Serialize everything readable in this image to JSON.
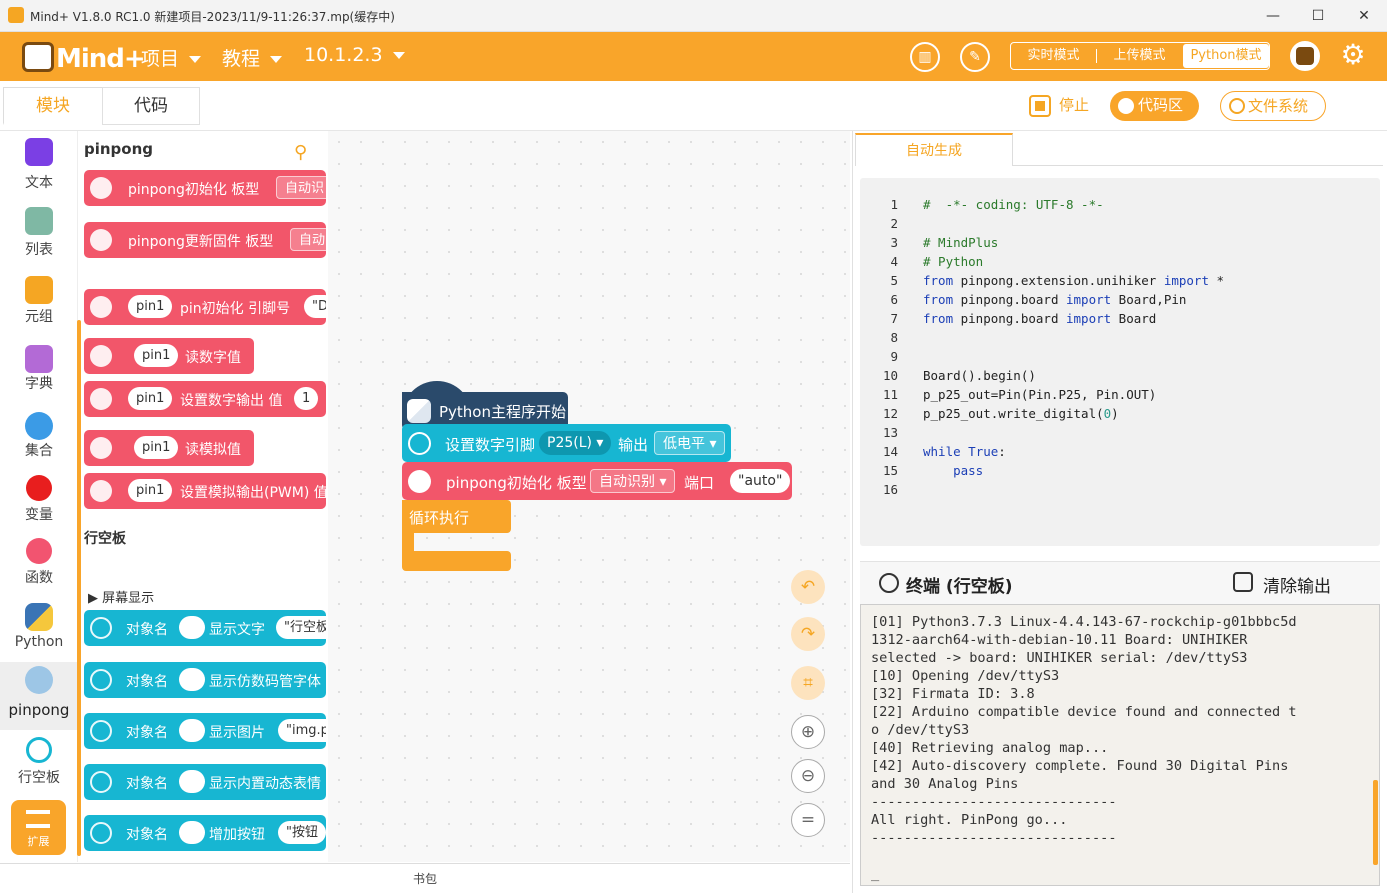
{
  "window": {
    "title": "Mind+ V1.8.0 RC1.0   新建项目-2023/11/9-11:26:37.mp(缓存中)",
    "minimize": "—",
    "maximize": "☐",
    "close": "✕"
  },
  "menubar": {
    "logo_text": "Mind+",
    "menus": [
      "项目",
      "教程",
      "10.1.2.3"
    ],
    "modes": [
      "实时模式",
      "上传模式",
      "Python模式"
    ]
  },
  "tabs": {
    "blocks": "模块",
    "code": "代码",
    "stop": "停止",
    "code_area": "代码区",
    "file_system": "文件系统"
  },
  "sidebar": {
    "items": [
      "文本",
      "列表",
      "元组",
      "字典",
      "集合",
      "变量",
      "函数",
      "Python",
      "pinpong",
      "行空板"
    ],
    "extend": "扩展"
  },
  "palette": {
    "section1": "pinpong",
    "section2": "行空板",
    "subsection": "屏幕显示",
    "red_blocks": [
      {
        "text": "pinpong初始化 板型",
        "slot": "自动识"
      },
      {
        "text": "pinpong更新固件 板型",
        "slot": "自动"
      },
      {
        "pin": "pin1",
        "text": "pin初始化 引脚号",
        "slot": "\"D"
      },
      {
        "pin": "pin1",
        "text": "读数字值",
        "slot": ""
      },
      {
        "pin": "pin1",
        "text": "设置数字输出 值",
        "slot": "1"
      },
      {
        "pin": "pin1",
        "text": "读模拟值",
        "slot": ""
      },
      {
        "pin": "pin1",
        "text": "设置模拟输出(PWM) 值",
        "slot": ""
      }
    ],
    "cyan_blocks": [
      {
        "obj": "对象名",
        "text": "显示文字",
        "slot": "\"行空板"
      },
      {
        "obj": "对象名",
        "text": "显示仿数码管字体",
        "slot": ""
      },
      {
        "obj": "对象名",
        "text": "显示图片",
        "slot": "\"img.p"
      },
      {
        "obj": "对象名",
        "text": "显示内置动态表情",
        "slot": ""
      },
      {
        "obj": "对象名",
        "text": "增加按钮",
        "slot": "\"按钮"
      }
    ]
  },
  "workspace": {
    "hat": "Python主程序开始",
    "digital": {
      "text": "设置数字引脚",
      "pin": "P25(L)",
      "out": "输出",
      "level": "低电平"
    },
    "init": {
      "text": "pinpong初始化 板型",
      "board": "自动识别",
      "port_label": "端口",
      "port": "\"auto\""
    },
    "loop": "循环执行"
  },
  "bag": "书包",
  "code": {
    "tab": "自动生成",
    "lines": [
      {
        "n": "1",
        "parts": [
          {
            "t": "#  -*- coding: UTF-8 -*-",
            "c": "cm"
          }
        ]
      },
      {
        "n": "2",
        "parts": []
      },
      {
        "n": "3",
        "parts": [
          {
            "t": "# MindPlus",
            "c": "cm"
          }
        ]
      },
      {
        "n": "4",
        "parts": [
          {
            "t": "# Python",
            "c": "cm"
          }
        ]
      },
      {
        "n": "5",
        "parts": [
          {
            "t": "from",
            "c": "kw"
          },
          {
            "t": " pinpong.extension.unihiker ",
            "c": ""
          },
          {
            "t": "import",
            "c": "kw"
          },
          {
            "t": " *",
            "c": ""
          }
        ]
      },
      {
        "n": "6",
        "parts": [
          {
            "t": "from",
            "c": "kw"
          },
          {
            "t": " pinpong.board ",
            "c": ""
          },
          {
            "t": "import",
            "c": "kw"
          },
          {
            "t": " Board,Pin",
            "c": ""
          }
        ]
      },
      {
        "n": "7",
        "parts": [
          {
            "t": "from",
            "c": "kw"
          },
          {
            "t": " pinpong.board ",
            "c": ""
          },
          {
            "t": "import",
            "c": "kw"
          },
          {
            "t": " Board",
            "c": ""
          }
        ]
      },
      {
        "n": "8",
        "parts": []
      },
      {
        "n": "9",
        "parts": []
      },
      {
        "n": "10",
        "parts": [
          {
            "t": "Board().begin()",
            "c": ""
          }
        ]
      },
      {
        "n": "11",
        "parts": [
          {
            "t": "p_p25_out=Pin(Pin.P25, Pin.OUT)",
            "c": ""
          }
        ]
      },
      {
        "n": "12",
        "parts": [
          {
            "t": "p_p25_out.write_digital(",
            "c": ""
          },
          {
            "t": "0",
            "c": "num"
          },
          {
            "t": ")",
            "c": ""
          }
        ]
      },
      {
        "n": "13",
        "parts": []
      },
      {
        "n": "14",
        "parts": [
          {
            "t": "while",
            "c": "kw"
          },
          {
            "t": " ",
            "c": ""
          },
          {
            "t": "True",
            "c": "kw"
          },
          {
            "t": ":",
            "c": ""
          }
        ]
      },
      {
        "n": "15",
        "parts": [
          {
            "t": "    ",
            "c": ""
          },
          {
            "t": "pass",
            "c": "kw"
          }
        ]
      },
      {
        "n": "16",
        "parts": []
      }
    ]
  },
  "terminal": {
    "title": "终端 (行空板)",
    "clear": "清除输出",
    "lines": [
      "[01] Python3.7.3 Linux-4.4.143-67-rockchip-g01bbbc5d",
      "1312-aarch64-with-debian-10.11 Board: UNIHIKER",
      "selected -> board: UNIHIKER serial: /dev/ttyS3",
      "[10] Opening /dev/ttyS3",
      "[32] Firmata ID: 3.8",
      "[22] Arduino compatible device found and connected t",
      "o /dev/ttyS3",
      "[40] Retrieving analog map...",
      "[42] Auto-discovery complete. Found 30 Digital Pins",
      "and 30 Analog Pins",
      "------------------------------",
      "All right. PinPong go...",
      "------------------------------",
      "",
      "_"
    ]
  },
  "colors": {
    "accent": "#f9a52a",
    "pinpong_block": "#f2566a",
    "unihiker_block": "#17b6d2",
    "python_hat": "#2a4a6b",
    "loop_block": "#f9a52a"
  }
}
